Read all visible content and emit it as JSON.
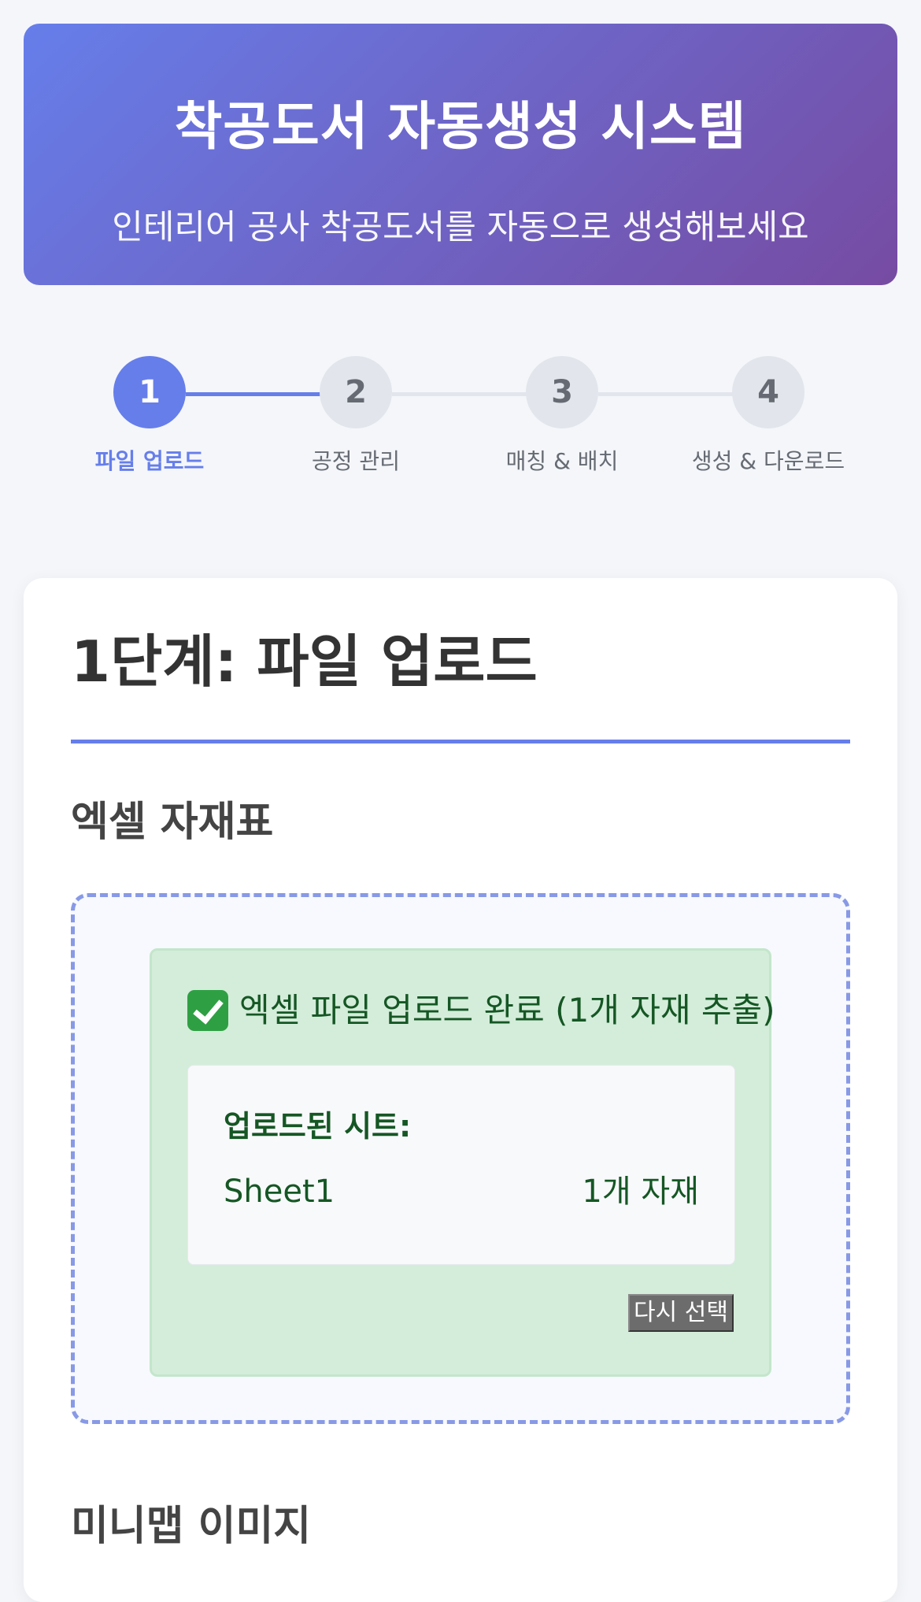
{
  "header": {
    "title": "착공도서 자동생성 시스템",
    "subtitle": "인테리어 공사 착공도서를 자동으로 생성해보세요"
  },
  "steps": [
    {
      "number": "1",
      "label": "파일 업로드",
      "active": true
    },
    {
      "number": "2",
      "label": "공정 관리",
      "active": false
    },
    {
      "number": "3",
      "label": "매칭 & 배치",
      "active": false
    },
    {
      "number": "4",
      "label": "생성 & 다운로드",
      "active": false
    }
  ],
  "main": {
    "title": "1단계: 파일 업로드",
    "excel_section": {
      "title": "엑셀 자재표",
      "success_message": "엑셀 파일 업로드 완료 (1개 자재 추출)",
      "success_icon": "check-icon",
      "sheets_heading": "업로드된 시트:",
      "sheets": [
        {
          "name": "Sheet1",
          "count": "1개 자재"
        }
      ],
      "reselect_label": "다시 선택"
    },
    "minimap_section": {
      "title": "미니맵 이미지"
    }
  },
  "colors": {
    "accent": "#667eea",
    "gradient_end": "#764ba2",
    "success_bg": "#d4edda",
    "success_text": "#155724"
  }
}
